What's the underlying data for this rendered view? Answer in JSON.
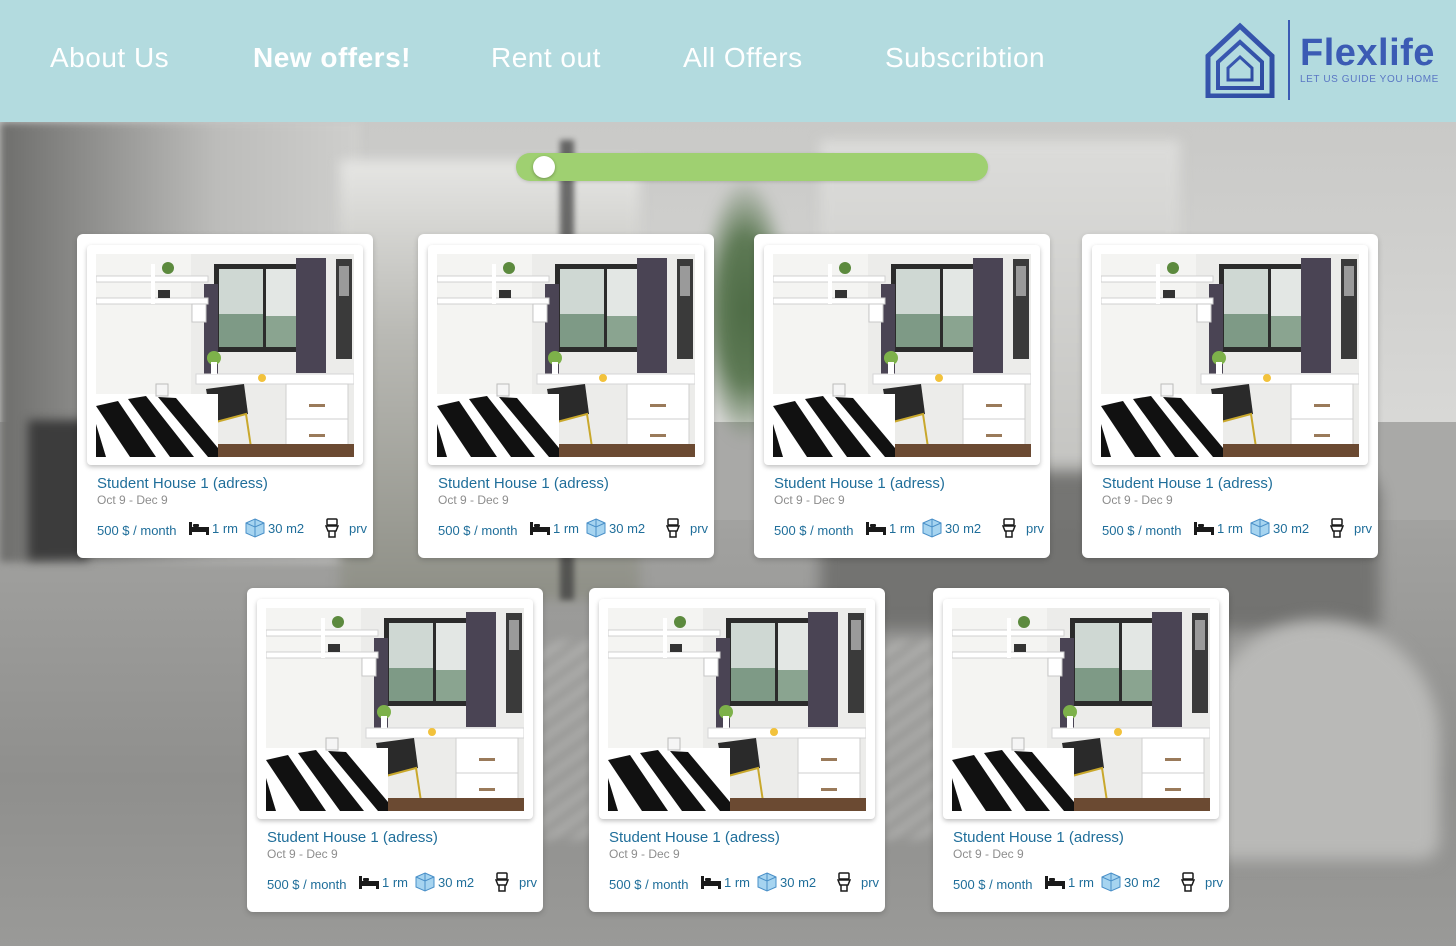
{
  "nav": {
    "items": [
      {
        "label": "About Us",
        "active": false
      },
      {
        "label": "New offers!",
        "active": true
      },
      {
        "label": "Rent out",
        "active": false
      },
      {
        "label": "All Offers",
        "active": false
      },
      {
        "label": "Subscribtion",
        "active": false
      }
    ]
  },
  "logo": {
    "brand": "Flexlife",
    "tagline": "LET US GUIDE YOU HOME"
  },
  "slider": {
    "value": 0.0
  },
  "colors": {
    "header_bg": "#b3dbdf",
    "accent_blue": "#1f6e9a",
    "logo_blue": "#3b5bb4",
    "slider_green": "#9fd071"
  },
  "listings": [
    {
      "title": "Student House 1 (adress)",
      "dates": "Oct 9 - Dec 9",
      "price": "500 $ / month",
      "rooms": "1 rm",
      "area": "30 m2",
      "bathroom": "prv",
      "icons": [
        "bed-icon",
        "cube-icon",
        "toilet-icon"
      ]
    },
    {
      "title": "Student House 1 (adress)",
      "dates": "Oct 9 - Dec 9",
      "price": "500 $ / month",
      "rooms": "1 rm",
      "area": "30 m2",
      "bathroom": "prv",
      "icons": [
        "bed-icon",
        "cube-icon",
        "toilet-icon"
      ]
    },
    {
      "title": "Student House 1 (adress)",
      "dates": "Oct 9 - Dec 9",
      "price": "500 $ / month",
      "rooms": "1 rm",
      "area": "30 m2",
      "bathroom": "prv",
      "icons": [
        "bed-icon",
        "cube-icon",
        "toilet-icon"
      ]
    },
    {
      "title": "Student House 1 (adress)",
      "dates": "Oct 9 - Dec 9",
      "price": "500 $ / month",
      "rooms": "1 rm",
      "area": "30 m2",
      "bathroom": "prv",
      "icons": [
        "bed-icon",
        "cube-icon",
        "toilet-icon"
      ]
    },
    {
      "title": "Student House 1 (adress)",
      "dates": "Oct 9 - Dec 9",
      "price": "500 $ / month",
      "rooms": "1 rm",
      "area": "30 m2",
      "bathroom": "prv",
      "icons": [
        "bed-icon",
        "cube-icon",
        "toilet-icon"
      ]
    },
    {
      "title": "Student House 1 (adress)",
      "dates": "Oct 9 - Dec 9",
      "price": "500 $ / month",
      "rooms": "1 rm",
      "area": "30 m2",
      "bathroom": "prv",
      "icons": [
        "bed-icon",
        "cube-icon",
        "toilet-icon"
      ]
    },
    {
      "title": "Student House 1 (adress)",
      "dates": "Oct 9 - Dec 9",
      "price": "500 $ / month",
      "rooms": "1 rm",
      "area": "30 m2",
      "bathroom": "prv",
      "icons": [
        "bed-icon",
        "cube-icon",
        "toilet-icon"
      ]
    }
  ]
}
